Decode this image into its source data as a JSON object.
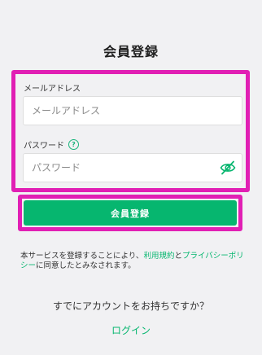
{
  "page": {
    "title": "会員登録"
  },
  "form": {
    "email": {
      "label": "メールアドレス",
      "placeholder": "メールアドレス",
      "value": ""
    },
    "password": {
      "label": "パスワード",
      "placeholder": "パスワード",
      "value": "",
      "help_icon": "?"
    }
  },
  "submit": {
    "label": "会員登録"
  },
  "terms": {
    "prefix": "本サービスを登録することにより、",
    "terms_link": "利用規約",
    "middle": "と",
    "privacy_link": "プライバシーポリシー",
    "suffix": "に同意したとみなされます。"
  },
  "login": {
    "prompt": "すでにアカウントをお持ちですか？",
    "link": "ログイン"
  },
  "colors": {
    "accent": "#06b66f",
    "highlight": "#e11fb4",
    "background": "#f1f1f3"
  },
  "icons": {
    "password_toggle": "eye-off-icon",
    "help": "help-circle-icon"
  }
}
